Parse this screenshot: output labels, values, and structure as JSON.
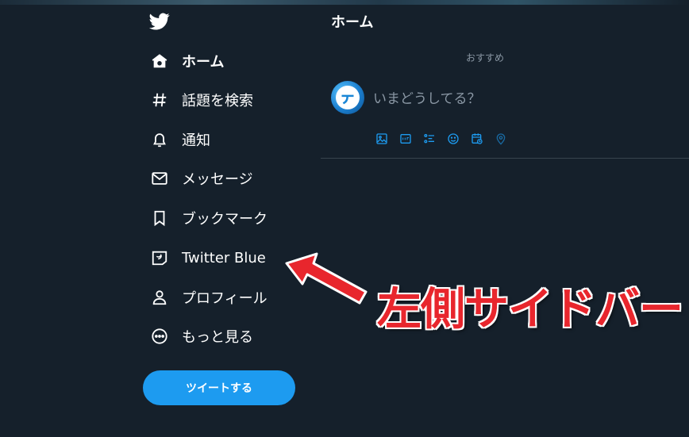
{
  "sidebar": {
    "logo_icon": "twitter-bird-icon",
    "items": [
      {
        "label": "ホーム",
        "icon": "home-icon",
        "active": true
      },
      {
        "label": "話題を検索",
        "icon": "hashtag-icon"
      },
      {
        "label": "通知",
        "icon": "bell-icon"
      },
      {
        "label": "メッセージ",
        "icon": "envelope-icon"
      },
      {
        "label": "ブックマーク",
        "icon": "bookmark-icon"
      },
      {
        "label": "Twitter Blue",
        "icon": "twitter-blue-icon"
      },
      {
        "label": "プロフィール",
        "icon": "person-icon"
      },
      {
        "label": "もっと見る",
        "icon": "more-circle-icon"
      }
    ],
    "tweet_button": "ツイートする"
  },
  "main": {
    "title": "ホーム",
    "subtab": "おすすめ",
    "compose": {
      "placeholder": "いまどうしてる？"
    },
    "toolbar": [
      "image-icon",
      "gif-icon",
      "poll-icon",
      "emoji-icon",
      "schedule-icon",
      "location-icon"
    ]
  },
  "annotation": {
    "text": "左側サイドバー",
    "color": "#e8262d"
  },
  "colors": {
    "background": "#15202b",
    "accent": "#1d9bf0",
    "divider": "#38444d",
    "muted": "#8b98a5"
  }
}
